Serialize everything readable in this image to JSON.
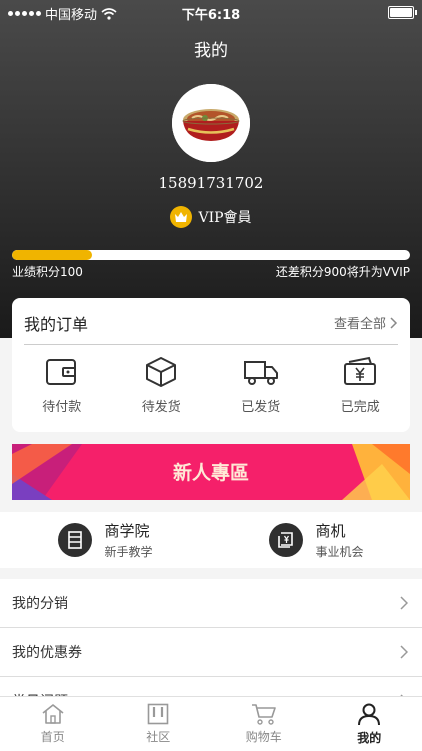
{
  "status_bar": {
    "carrier": "中国移动",
    "time": "下午6:18"
  },
  "header": {
    "title": "我的"
  },
  "profile": {
    "phone": "15891731702",
    "vip_label": "VIP會員",
    "progress_fraction": 0.2
  },
  "score": {
    "current_label": "业绩积分100",
    "upgrade_label": "还差积分900将升为VVIP"
  },
  "orders": {
    "title": "我的订单",
    "view_all": "查看全部",
    "items": [
      {
        "label": "待付款",
        "icon": "wallet-icon"
      },
      {
        "label": "待发货",
        "icon": "package-icon"
      },
      {
        "label": "已发货",
        "icon": "truck-icon"
      },
      {
        "label": "已完成",
        "icon": "yen-card-icon"
      }
    ]
  },
  "banner": {
    "text": "新人專區"
  },
  "features": [
    {
      "title": "商学院",
      "subtitle": "新手教学",
      "icon": "book-icon"
    },
    {
      "title": "商机",
      "subtitle": "事业机会",
      "icon": "opportunity-icon"
    }
  ],
  "menu": [
    {
      "label": "我的分销"
    },
    {
      "label": "我的优惠券"
    },
    {
      "label": "常见问题"
    }
  ],
  "tabbar": [
    {
      "label": "首页",
      "icon": "home-icon"
    },
    {
      "label": "社区",
      "icon": "community-icon"
    },
    {
      "label": "购物车",
      "icon": "cart-icon"
    },
    {
      "label": "我的",
      "icon": "user-icon"
    }
  ],
  "colors": {
    "accent": "#f0b400",
    "banner": "#f5206a",
    "header_dark": "#1a1a1a"
  }
}
